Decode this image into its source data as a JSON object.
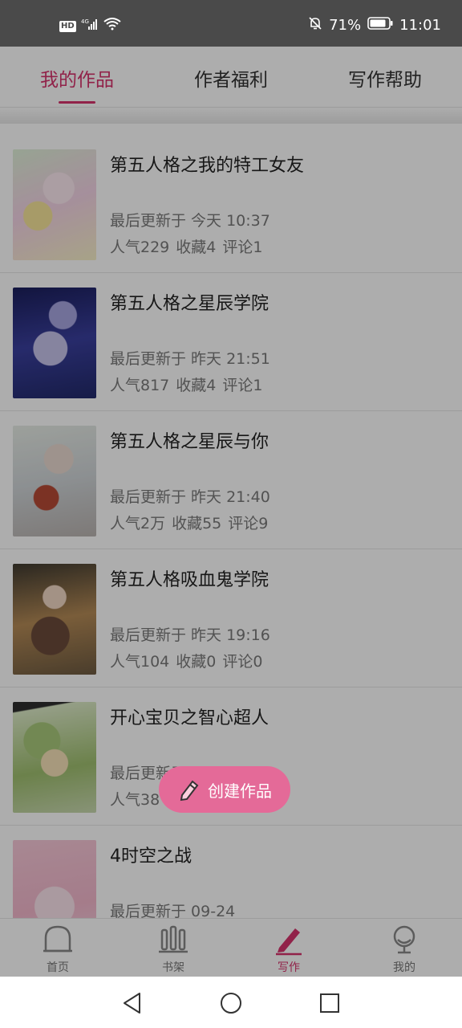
{
  "status_bar": {
    "hd": "HD",
    "network": "4G",
    "battery": "71%",
    "time": "11:01"
  },
  "tabs": [
    {
      "label": "我的作品",
      "active": true
    },
    {
      "label": "作者福利",
      "active": false
    },
    {
      "label": "写作帮助",
      "active": false
    }
  ],
  "works": [
    {
      "title": "第五人格之我的特工女友",
      "updated": "最后更新于 今天 10:37",
      "popularity": "人气229",
      "favorites": "收藏4",
      "comments": "评论1"
    },
    {
      "title": "第五人格之星辰学院",
      "updated": "最后更新于 昨天 21:51",
      "popularity": "人气817",
      "favorites": "收藏4",
      "comments": "评论1"
    },
    {
      "title": "第五人格之星辰与你",
      "updated": "最后更新于 昨天 21:40",
      "popularity": "人气2万",
      "favorites": "收藏55",
      "comments": "评论9"
    },
    {
      "title": "第五人格吸血鬼学院",
      "updated": "最后更新于 昨天 19:16",
      "popularity": "人气104",
      "favorites": "收藏0",
      "comments": "评论0"
    },
    {
      "title": "开心宝贝之智心超人",
      "updated": "最后更新于",
      "popularity": "人气38",
      "favorites": "",
      "comments": ""
    },
    {
      "title": "4时空之战",
      "updated": "最后更新于 09-24",
      "popularity": "",
      "favorites": "",
      "comments": ""
    }
  ],
  "fab": {
    "label": "创建作品",
    "icon": "pencil-icon"
  },
  "bottom_nav": [
    {
      "label": "首页",
      "icon": "home-icon",
      "active": false
    },
    {
      "label": "书架",
      "icon": "bookshelf-icon",
      "active": false
    },
    {
      "label": "写作",
      "icon": "pen-icon",
      "active": true
    },
    {
      "label": "我的",
      "icon": "profile-icon",
      "active": false
    }
  ],
  "system_nav": [
    "back-icon",
    "home-circle-icon",
    "recents-icon"
  ],
  "colors": {
    "accent": "#d6336c",
    "fab": "#e46a98",
    "statusbar": "#4a4a4a"
  }
}
